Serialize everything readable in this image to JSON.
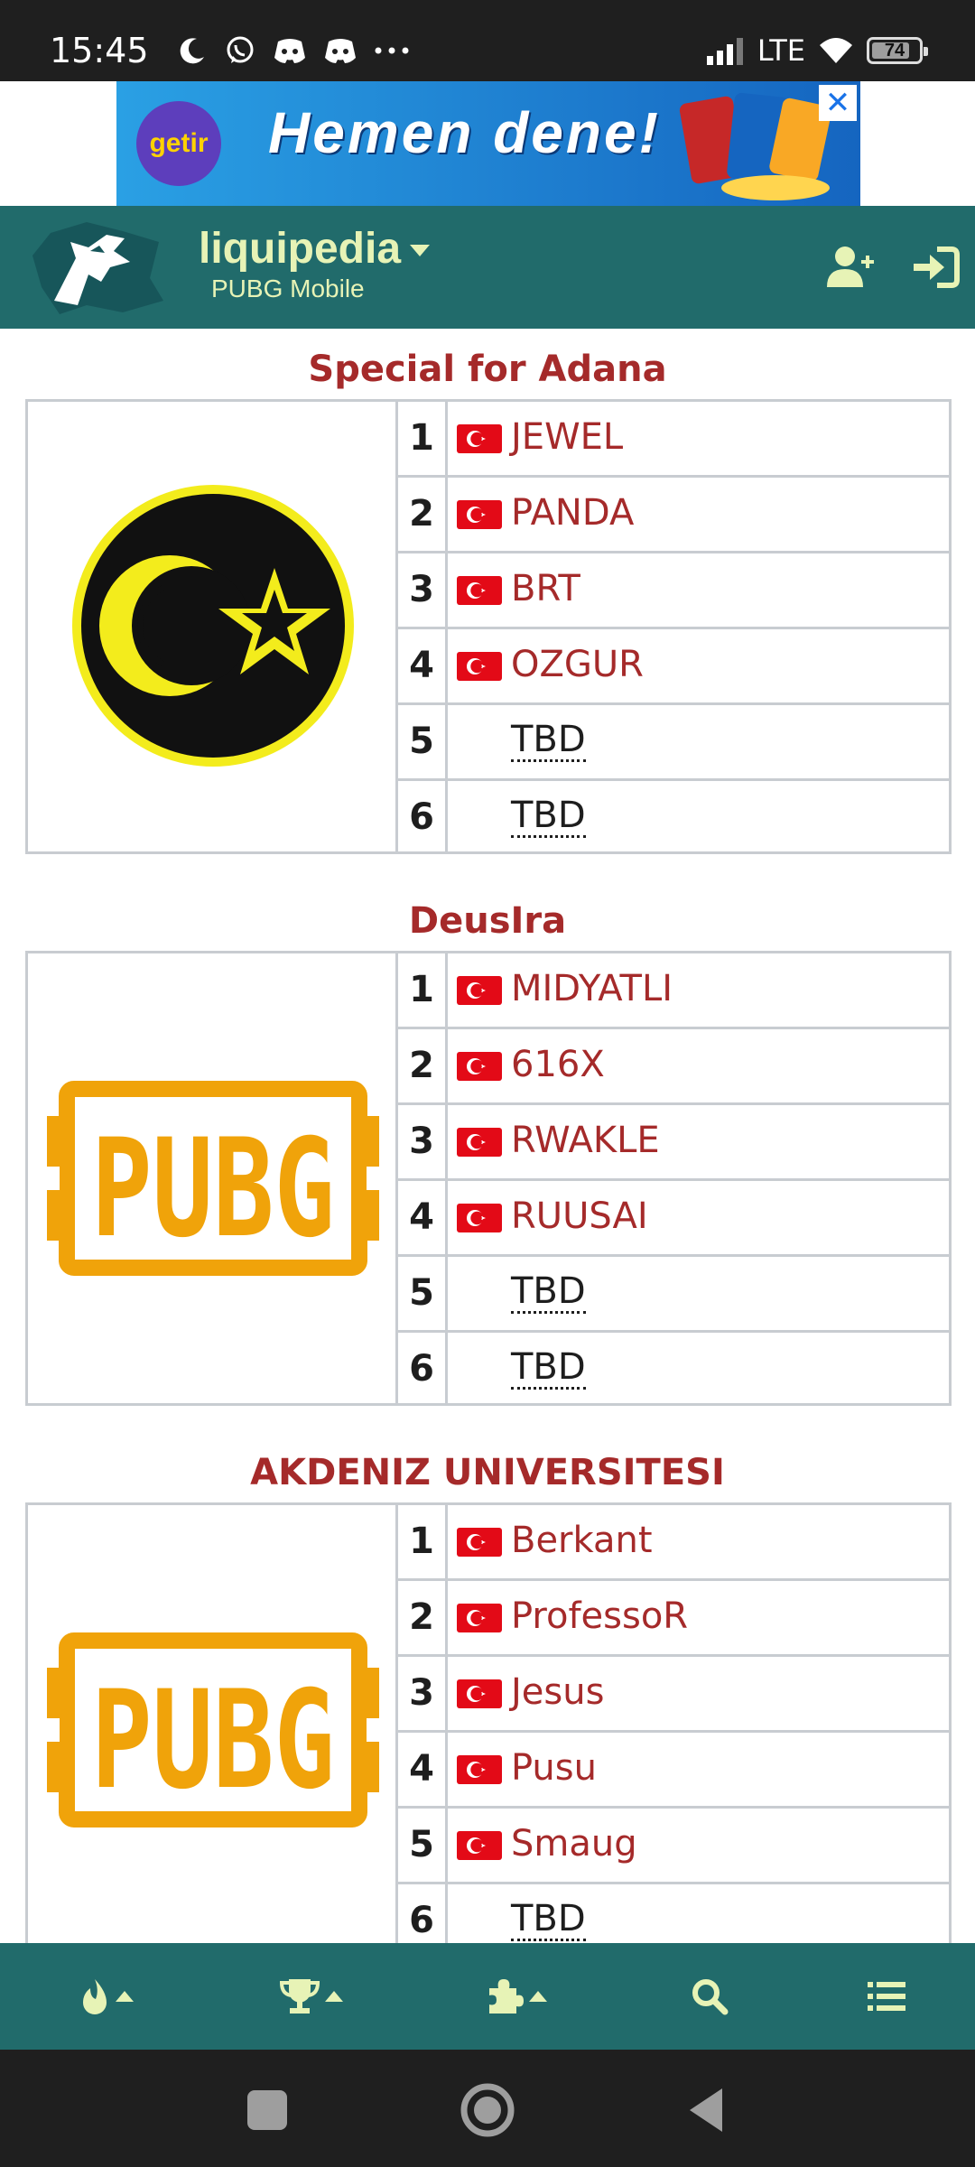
{
  "status_bar": {
    "time": "15:45",
    "network": "LTE",
    "battery": "74"
  },
  "ad": {
    "brand": "getir",
    "headline": "Hemen dene!",
    "close_label": "✕"
  },
  "header": {
    "brand": "liquipedia",
    "subtitle": "PUBG Mobile",
    "icons": [
      "logo-icon",
      "add-user-icon",
      "sign-in-icon"
    ]
  },
  "teams": [
    {
      "name": "Special for Adana",
      "logo": "crescent-star-logo",
      "players": [
        {
          "num": "1",
          "name": "JEWEL",
          "flag": "turkey"
        },
        {
          "num": "2",
          "name": "PANDA",
          "flag": "turkey"
        },
        {
          "num": "3",
          "name": "BRT",
          "flag": "turkey"
        },
        {
          "num": "4",
          "name": "OZGUR",
          "flag": "turkey"
        },
        {
          "num": "5",
          "name": "TBD",
          "flag": ""
        },
        {
          "num": "6",
          "name": "TBD",
          "flag": ""
        }
      ]
    },
    {
      "name": "DeusIra",
      "logo": "pubg-logo",
      "players": [
        {
          "num": "1",
          "name": "MIDYATLI",
          "flag": "turkey"
        },
        {
          "num": "2",
          "name": "616X",
          "flag": "turkey"
        },
        {
          "num": "3",
          "name": "RWAKLE",
          "flag": "turkey"
        },
        {
          "num": "4",
          "name": "RUUSAI",
          "flag": "turkey"
        },
        {
          "num": "5",
          "name": "TBD",
          "flag": ""
        },
        {
          "num": "6",
          "name": "TBD",
          "flag": ""
        }
      ]
    },
    {
      "name": "AKDENIZ UNIVERSITESI",
      "logo": "pubg-logo",
      "players": [
        {
          "num": "1",
          "name": "Berkant",
          "flag": "turkey"
        },
        {
          "num": "2",
          "name": "ProfessoR",
          "flag": "turkey"
        },
        {
          "num": "3",
          "name": "Jesus",
          "flag": "turkey"
        },
        {
          "num": "4",
          "name": "Pusu",
          "flag": "turkey"
        },
        {
          "num": "5",
          "name": "Smaug",
          "flag": "turkey"
        },
        {
          "num": "6",
          "name": "TBD",
          "flag": ""
        }
      ]
    }
  ],
  "bottom_nav": {
    "items": [
      "flame-icon",
      "trophy-icon",
      "puzzle-icon",
      "search-icon",
      "list-icon"
    ]
  },
  "colors": {
    "header_bg": "#216b6b",
    "brand_text": "#e7f3b6",
    "team_title": "#a52a2a",
    "player_link": "#a52a2a",
    "pubg_orange": "#f0a30a",
    "emblem_yellow": "#f3ec1c"
  }
}
